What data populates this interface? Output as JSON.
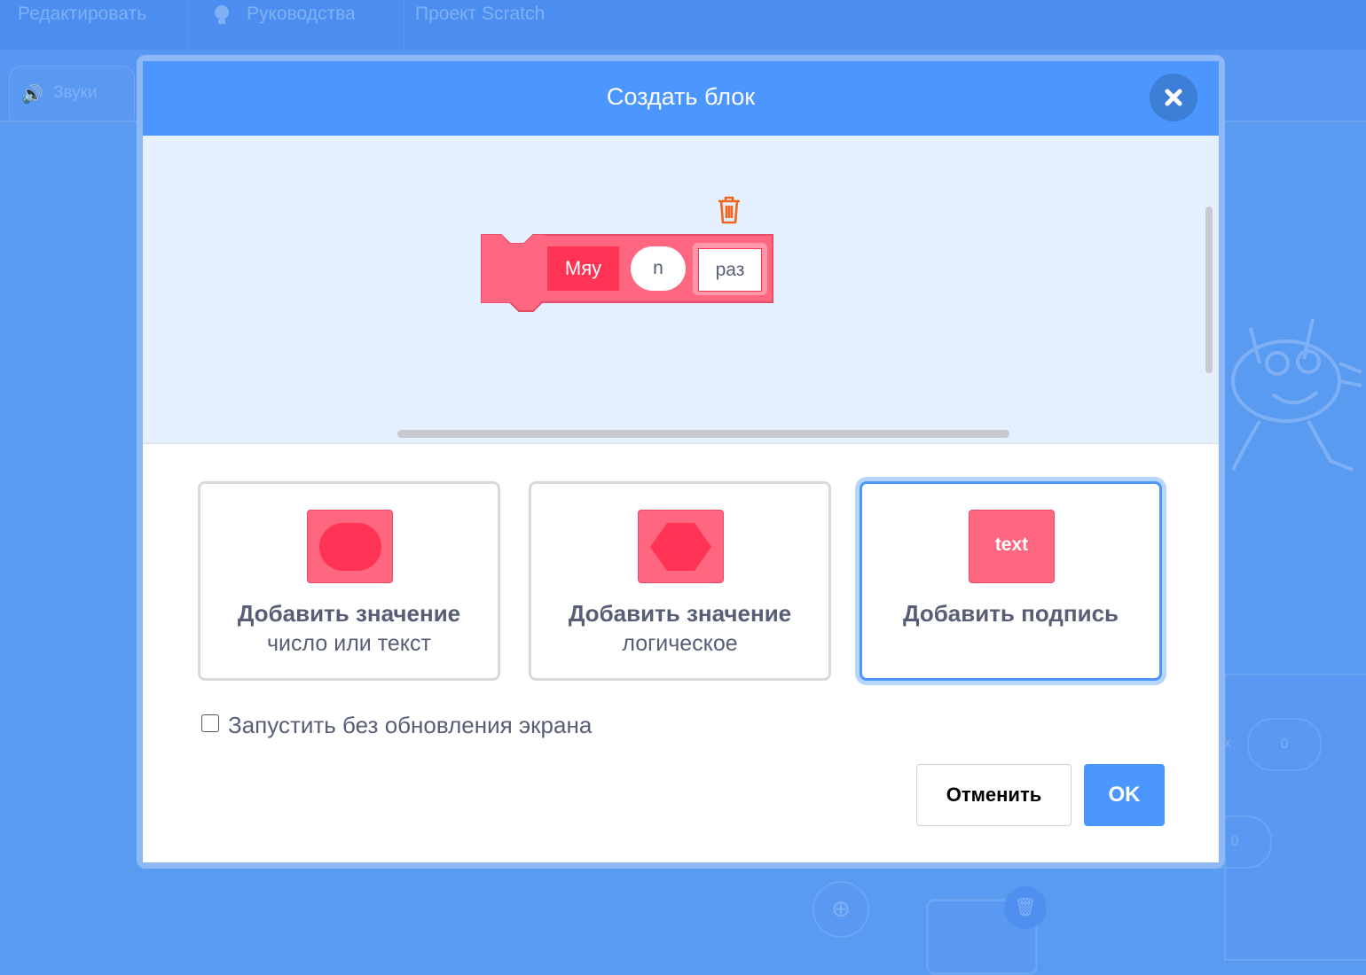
{
  "background": {
    "menu": [
      {
        "label": "Редактировать"
      },
      {
        "label": "Руководства"
      },
      {
        "label": "Проект Scratch"
      }
    ],
    "sounds_tab": "Звуки",
    "coord_x_label": "x",
    "coord_x_value": "0",
    "coord_y_value": "0"
  },
  "dialog": {
    "title": "Создать блок",
    "close_icon": "×",
    "block": {
      "label": "Мяу",
      "input_value": "n",
      "text_value": "раз"
    },
    "options": [
      {
        "title": "Добавить значение",
        "subtitle": "число или текст",
        "icon": "rounded-input-icon"
      },
      {
        "title": "Добавить значение",
        "subtitle": "логическое",
        "icon": "boolean-input-icon"
      },
      {
        "title": "Добавить подпись",
        "subtitle": "",
        "icon_text": "text",
        "selected": true
      }
    ],
    "warp_label": "Запустить без обновления экрана",
    "warp_checked": false,
    "cancel_label": "Отменить",
    "ok_label": "OK"
  },
  "colors": {
    "header": "#4c97ff",
    "block": "#ff6680",
    "block_dark": "#ff3355",
    "workspace": "#e5f0ff",
    "accent": "#4c97ff"
  }
}
